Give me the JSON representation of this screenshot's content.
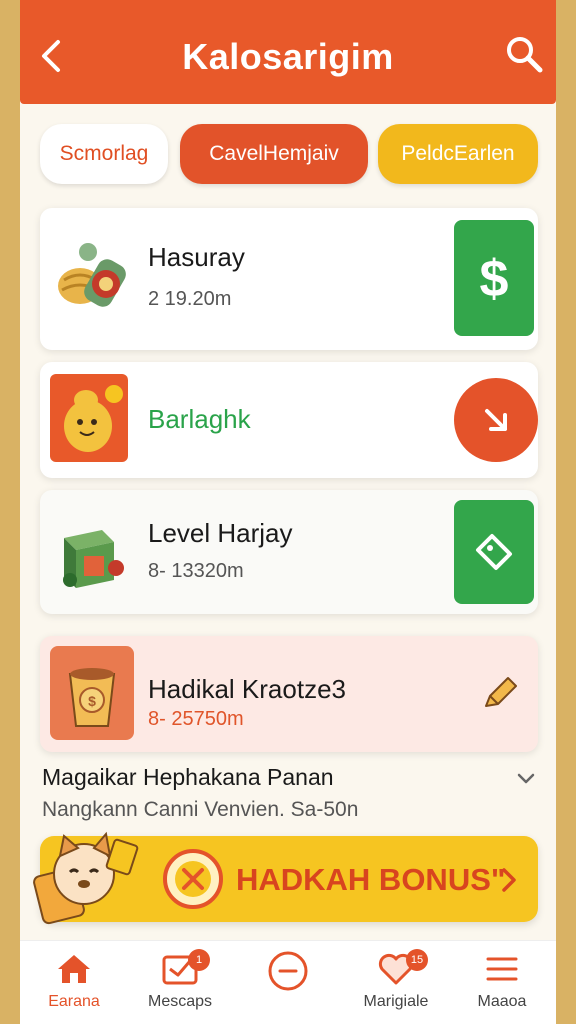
{
  "header": {
    "title": "Kalosarigim",
    "back_icon": "chevron-left-icon",
    "search_icon": "search-icon"
  },
  "chips": [
    {
      "label": "Scmorlag",
      "color": "#ffffff"
    },
    {
      "label": "CavelHemjaiv",
      "color": "#e2532a"
    },
    {
      "label": "PeldcEarlen",
      "color": "#f2b81c"
    }
  ],
  "cards": [
    {
      "name": "Hasuray",
      "meta": "2  19.20m",
      "action_icon": "dollar-icon"
    },
    {
      "name": "Barlaghk",
      "action_icon": "arrow-down-right-icon"
    },
    {
      "name": "Level Harjay",
      "meta": "8- 13320m",
      "action_icon": "tag-icon"
    },
    {
      "name": "Hadikal Kraotze3",
      "meta": "8- 25750m",
      "action_icon": "pencil-icon"
    }
  ],
  "info": {
    "line1": "Magaikar Hephakana Panan",
    "line2": "Nangkann  Canni Venvien. Sa-50n"
  },
  "bonus": {
    "label": "HADKAH BONUS\"",
    "color": "#f6c521"
  },
  "nav": [
    {
      "label": "Earana",
      "icon": "home-icon",
      "active": true
    },
    {
      "label": "Mescaps",
      "icon": "message-icon",
      "badge": "1"
    },
    {
      "label": "",
      "icon": "chat-icon"
    },
    {
      "label": "Marigiale",
      "icon": "heart-icon",
      "badge": "15"
    },
    {
      "label": "Maaoa",
      "icon": "menu-icon"
    }
  ],
  "colors": {
    "accent": "#e8592a",
    "green": "#33a64b",
    "yellow": "#f6c521"
  }
}
